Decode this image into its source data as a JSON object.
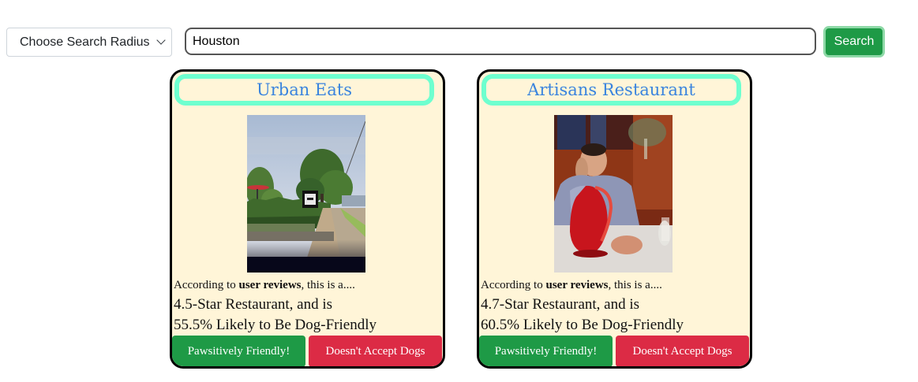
{
  "search": {
    "radius_label": "Choose Search Radius",
    "query_value": "Houston",
    "button_label": "Search"
  },
  "results": [
    {
      "name": "Urban Eats",
      "photo": "street-view-photo",
      "caption_prefix": "According to ",
      "caption_bold": "user reviews",
      "caption_suffix": ", this is a....",
      "rating_line": "4.5-Star Restaurant, and is",
      "dog_line": "55.5% Likely to Be Dog-Friendly",
      "friendly_label": "Pawsitively Friendly!",
      "no_dogs_label": "Doesn't Accept Dogs"
    },
    {
      "name": "Artisans Restaurant",
      "photo": "diner-photo",
      "caption_prefix": "According to ",
      "caption_bold": "user reviews",
      "caption_suffix": ", this is a....",
      "rating_line": "4.7-Star Restaurant, and is",
      "dog_line": "60.5% Likely to Be Dog-Friendly",
      "friendly_label": "Pawsitively Friendly!",
      "no_dogs_label": "Doesn't Accept Dogs"
    }
  ],
  "colors": {
    "accent_green": "#1e9a46",
    "accent_red": "#dc2b45",
    "title_border": "#6effcf",
    "title_text": "#3a84de",
    "card_bg": "#fff5d8"
  }
}
